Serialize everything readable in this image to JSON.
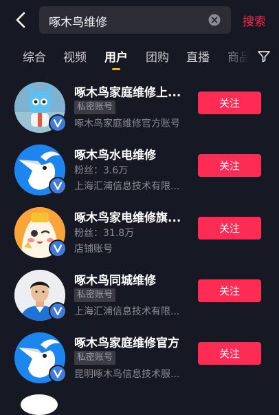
{
  "search": {
    "query": "啄木鸟维修",
    "submit_label": "搜索"
  },
  "tabs": [
    {
      "label": "综合",
      "active": false
    },
    {
      "label": "视频",
      "active": false
    },
    {
      "label": "用户",
      "active": true
    },
    {
      "label": "团购",
      "active": false
    },
    {
      "label": "直播",
      "active": false
    },
    {
      "label": "商品",
      "active": false
    }
  ],
  "colors": {
    "accent": "#fe2c55",
    "background": "#161823",
    "tab_indicator": "#ffb300",
    "verified": "#3f7cd8"
  },
  "results": [
    {
      "name": "啄木鸟家庭维修上...",
      "tag": "私密账号",
      "desc": "啄木鸟家庭维修官方账号",
      "follow_label": "关注",
      "avatar": "mascot-3d-avatar",
      "verified": true
    },
    {
      "name": "啄木鸟水电维修",
      "fans": "粉丝：3.6万",
      "desc": "上海汇浦信息技术有限...",
      "follow_label": "关注",
      "avatar": "woodpecker-logo-avatar",
      "verified": true
    },
    {
      "name": "啄木鸟家电维修旗...",
      "fans": "粉丝：31.8万",
      "desc": "店铺账号",
      "follow_label": "关注",
      "avatar": "cartoon-mascot-avatar",
      "verified": true
    },
    {
      "name": "啄木鸟同城维修",
      "tag": "私密账号",
      "desc": "上海汇浦信息技术有限...",
      "follow_label": "关注",
      "avatar": "person-photo-avatar",
      "verified": true
    },
    {
      "name": "啄木鸟家庭维修官方",
      "tag": "私密账号",
      "desc": "昆明啄木鸟信息技术服...",
      "follow_label": "关注",
      "avatar": "woodpecker-logo-avatar",
      "verified": true
    }
  ]
}
